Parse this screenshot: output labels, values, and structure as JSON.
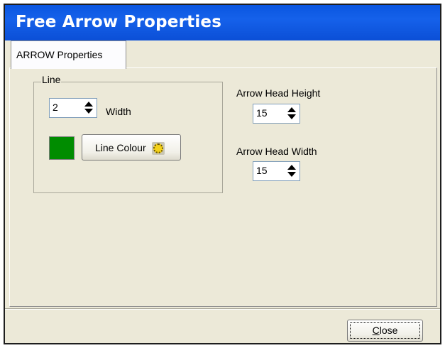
{
  "window": {
    "title": "Free Arrow Properties"
  },
  "tabs": [
    {
      "label": "ARROW Properties",
      "selected": true
    }
  ],
  "line_group": {
    "legend": "Line",
    "width_value": "2",
    "width_label": "Width",
    "swatch_color": "#008c00",
    "colour_button_label": "Line Colour"
  },
  "arrow_head": {
    "height_label": "Arrow Head Height",
    "height_value": "15",
    "width_label": "Arrow Head Width",
    "width_value": "15"
  },
  "footer": {
    "close_label_mnemonic": "C",
    "close_label_rest": "lose"
  },
  "icons": {
    "spin_arrows": "up-down-arrow-icon",
    "palette": "color-palette-icon"
  }
}
